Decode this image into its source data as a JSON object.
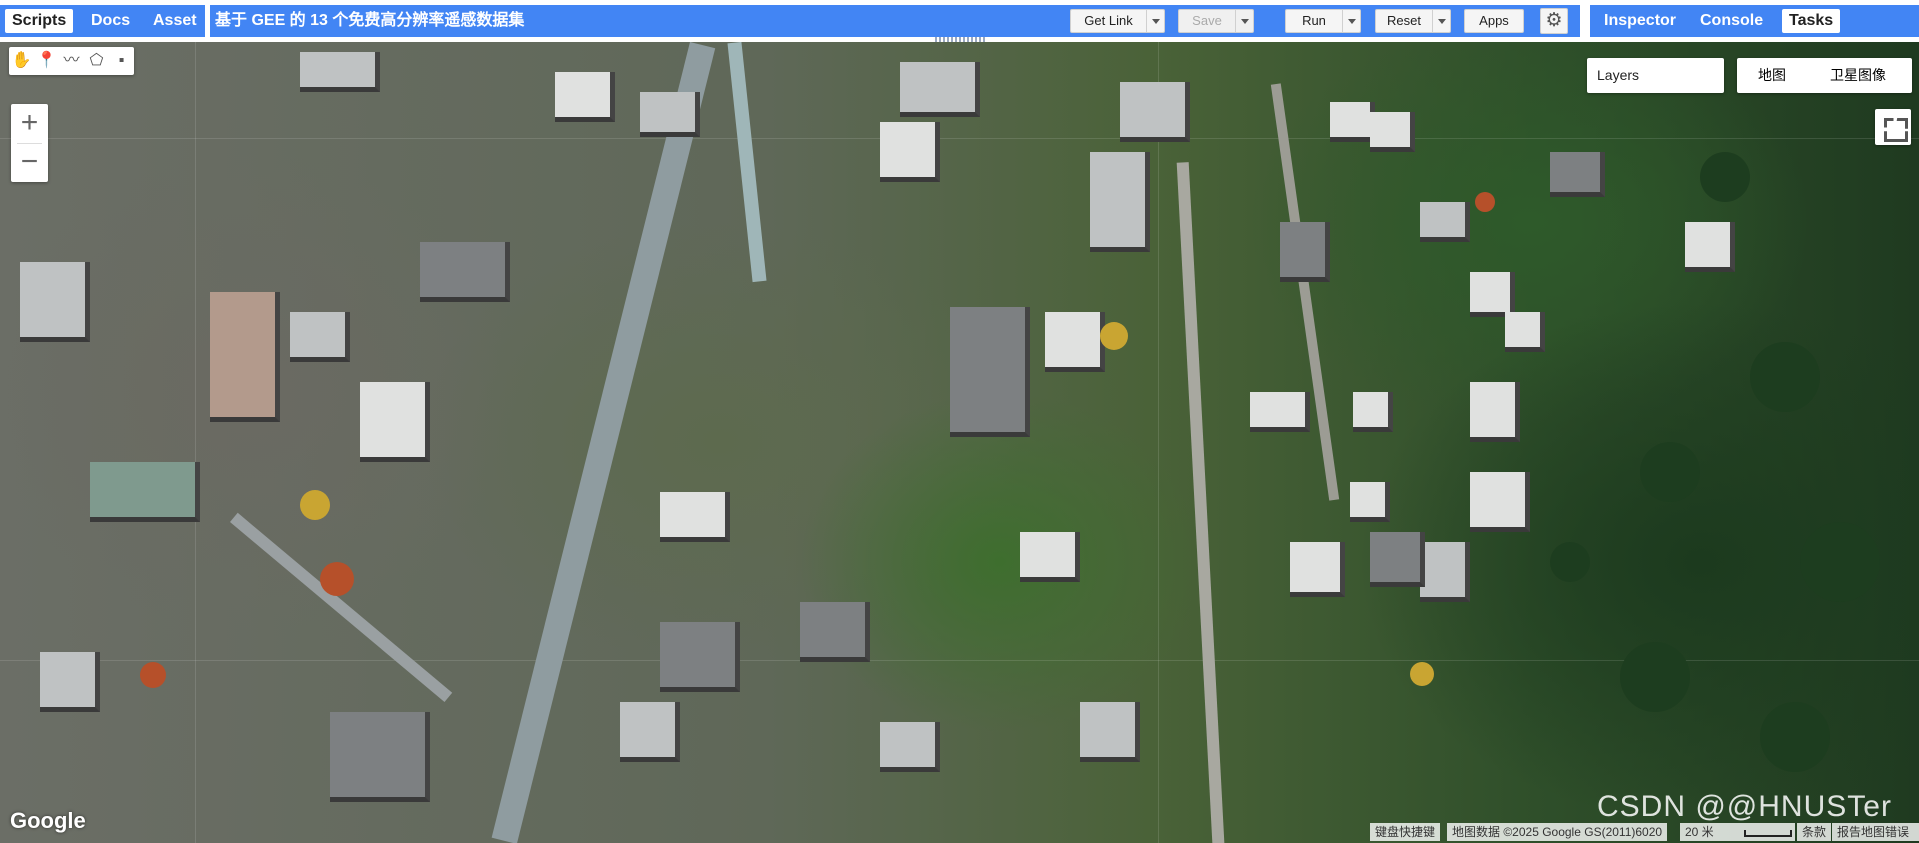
{
  "left_panel": {
    "tabs": [
      {
        "label": "Scripts",
        "active": true
      },
      {
        "label": "Docs",
        "active": false
      },
      {
        "label": "Asset",
        "active": false
      }
    ]
  },
  "editor": {
    "script_title": "基于 GEE 的 13 个免费高分辨率遥感数据集",
    "get_link_label": "Get Link",
    "save_label": "Save",
    "run_label": "Run",
    "reset_label": "Reset",
    "apps_label": "Apps",
    "settings_icon": "gear-icon"
  },
  "right_panel": {
    "tabs": [
      {
        "label": "Inspector",
        "active": false
      },
      {
        "label": "Console",
        "active": false
      },
      {
        "label": "Tasks",
        "active": true
      }
    ]
  },
  "map": {
    "drawing_tools": [
      "hand-icon",
      "marker-icon",
      "line-icon",
      "polygon-icon",
      "rectangle-icon"
    ],
    "zoom_in": "+",
    "zoom_out": "−",
    "layers_label": "Layers",
    "map_type_options": [
      "地图",
      "卫星图像"
    ],
    "map_type_selected": "卫星图像",
    "fullscreen_icon": "fullscreen-icon",
    "google_logo": "Google",
    "attribution": {
      "keyboard_shortcuts": "键盘快捷键",
      "map_data": "地图数据 ©2025 Google GS(2011)6020",
      "scale": "20 米",
      "terms": "条款",
      "report": "报告地图错误"
    },
    "watermark": "CSDN @@HNUSTer"
  },
  "colors": {
    "header_blue": "#4285f4",
    "panel_white": "#ffffff"
  }
}
